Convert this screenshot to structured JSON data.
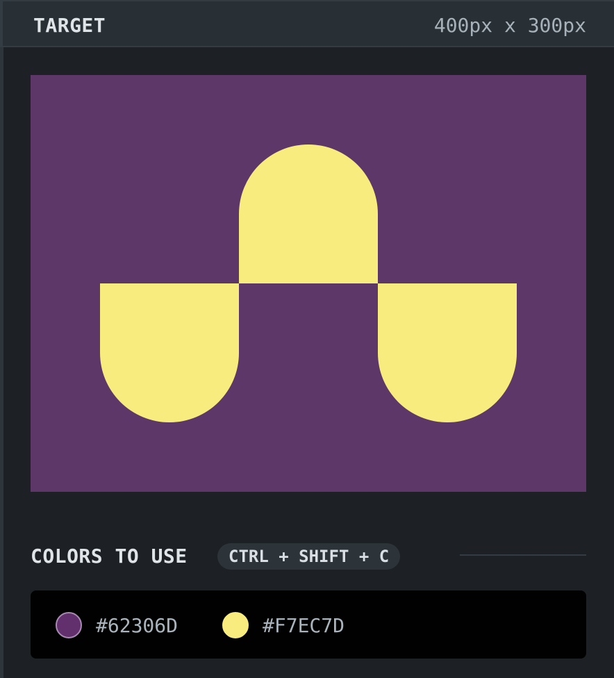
{
  "header": {
    "title": "TARGET",
    "dimensions": "400px x 300px"
  },
  "target": {
    "background_color": "#5C3768",
    "shape_color": "#F7EC7D"
  },
  "colors_section": {
    "heading": "COLORS TO USE",
    "shortcut": "CTRL + SHIFT + C",
    "colors": [
      {
        "hex": "#62306D",
        "swatch": "#62306D"
      },
      {
        "hex": "#F7EC7D",
        "swatch": "#F7EC7D"
      }
    ]
  }
}
